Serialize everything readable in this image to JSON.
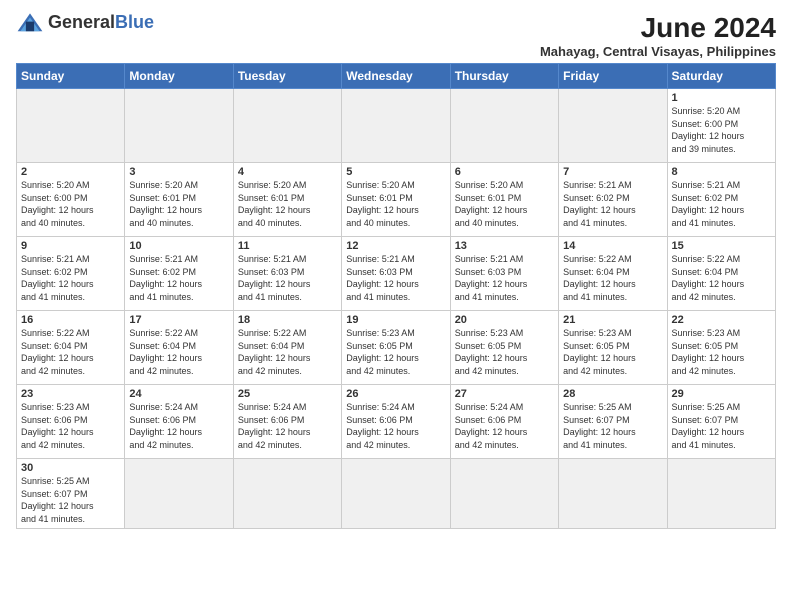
{
  "header": {
    "logo_general": "General",
    "logo_blue": "Blue",
    "month_year": "June 2024",
    "location": "Mahayag, Central Visayas, Philippines"
  },
  "days_of_week": [
    "Sunday",
    "Monday",
    "Tuesday",
    "Wednesday",
    "Thursday",
    "Friday",
    "Saturday"
  ],
  "weeks": [
    [
      {
        "day": "",
        "info": "",
        "empty": true
      },
      {
        "day": "",
        "info": "",
        "empty": true
      },
      {
        "day": "",
        "info": "",
        "empty": true
      },
      {
        "day": "",
        "info": "",
        "empty": true
      },
      {
        "day": "",
        "info": "",
        "empty": true
      },
      {
        "day": "",
        "info": "",
        "empty": true
      },
      {
        "day": "1",
        "info": "Sunrise: 5:20 AM\nSunset: 6:00 PM\nDaylight: 12 hours\nand 39 minutes.",
        "empty": false
      }
    ],
    [
      {
        "day": "2",
        "info": "Sunrise: 5:20 AM\nSunset: 6:00 PM\nDaylight: 12 hours\nand 40 minutes.",
        "empty": false
      },
      {
        "day": "3",
        "info": "Sunrise: 5:20 AM\nSunset: 6:01 PM\nDaylight: 12 hours\nand 40 minutes.",
        "empty": false
      },
      {
        "day": "4",
        "info": "Sunrise: 5:20 AM\nSunset: 6:01 PM\nDaylight: 12 hours\nand 40 minutes.",
        "empty": false
      },
      {
        "day": "5",
        "info": "Sunrise: 5:20 AM\nSunset: 6:01 PM\nDaylight: 12 hours\nand 40 minutes.",
        "empty": false
      },
      {
        "day": "6",
        "info": "Sunrise: 5:20 AM\nSunset: 6:01 PM\nDaylight: 12 hours\nand 40 minutes.",
        "empty": false
      },
      {
        "day": "7",
        "info": "Sunrise: 5:21 AM\nSunset: 6:02 PM\nDaylight: 12 hours\nand 41 minutes.",
        "empty": false
      },
      {
        "day": "8",
        "info": "Sunrise: 5:21 AM\nSunset: 6:02 PM\nDaylight: 12 hours\nand 41 minutes.",
        "empty": false
      }
    ],
    [
      {
        "day": "9",
        "info": "Sunrise: 5:21 AM\nSunset: 6:02 PM\nDaylight: 12 hours\nand 41 minutes.",
        "empty": false
      },
      {
        "day": "10",
        "info": "Sunrise: 5:21 AM\nSunset: 6:02 PM\nDaylight: 12 hours\nand 41 minutes.",
        "empty": false
      },
      {
        "day": "11",
        "info": "Sunrise: 5:21 AM\nSunset: 6:03 PM\nDaylight: 12 hours\nand 41 minutes.",
        "empty": false
      },
      {
        "day": "12",
        "info": "Sunrise: 5:21 AM\nSunset: 6:03 PM\nDaylight: 12 hours\nand 41 minutes.",
        "empty": false
      },
      {
        "day": "13",
        "info": "Sunrise: 5:21 AM\nSunset: 6:03 PM\nDaylight: 12 hours\nand 41 minutes.",
        "empty": false
      },
      {
        "day": "14",
        "info": "Sunrise: 5:22 AM\nSunset: 6:04 PM\nDaylight: 12 hours\nand 41 minutes.",
        "empty": false
      },
      {
        "day": "15",
        "info": "Sunrise: 5:22 AM\nSunset: 6:04 PM\nDaylight: 12 hours\nand 42 minutes.",
        "empty": false
      }
    ],
    [
      {
        "day": "16",
        "info": "Sunrise: 5:22 AM\nSunset: 6:04 PM\nDaylight: 12 hours\nand 42 minutes.",
        "empty": false
      },
      {
        "day": "17",
        "info": "Sunrise: 5:22 AM\nSunset: 6:04 PM\nDaylight: 12 hours\nand 42 minutes.",
        "empty": false
      },
      {
        "day": "18",
        "info": "Sunrise: 5:22 AM\nSunset: 6:04 PM\nDaylight: 12 hours\nand 42 minutes.",
        "empty": false
      },
      {
        "day": "19",
        "info": "Sunrise: 5:23 AM\nSunset: 6:05 PM\nDaylight: 12 hours\nand 42 minutes.",
        "empty": false
      },
      {
        "day": "20",
        "info": "Sunrise: 5:23 AM\nSunset: 6:05 PM\nDaylight: 12 hours\nand 42 minutes.",
        "empty": false
      },
      {
        "day": "21",
        "info": "Sunrise: 5:23 AM\nSunset: 6:05 PM\nDaylight: 12 hours\nand 42 minutes.",
        "empty": false
      },
      {
        "day": "22",
        "info": "Sunrise: 5:23 AM\nSunset: 6:05 PM\nDaylight: 12 hours\nand 42 minutes.",
        "empty": false
      }
    ],
    [
      {
        "day": "23",
        "info": "Sunrise: 5:23 AM\nSunset: 6:06 PM\nDaylight: 12 hours\nand 42 minutes.",
        "empty": false
      },
      {
        "day": "24",
        "info": "Sunrise: 5:24 AM\nSunset: 6:06 PM\nDaylight: 12 hours\nand 42 minutes.",
        "empty": false
      },
      {
        "day": "25",
        "info": "Sunrise: 5:24 AM\nSunset: 6:06 PM\nDaylight: 12 hours\nand 42 minutes.",
        "empty": false
      },
      {
        "day": "26",
        "info": "Sunrise: 5:24 AM\nSunset: 6:06 PM\nDaylight: 12 hours\nand 42 minutes.",
        "empty": false
      },
      {
        "day": "27",
        "info": "Sunrise: 5:24 AM\nSunset: 6:06 PM\nDaylight: 12 hours\nand 42 minutes.",
        "empty": false
      },
      {
        "day": "28",
        "info": "Sunrise: 5:25 AM\nSunset: 6:07 PM\nDaylight: 12 hours\nand 41 minutes.",
        "empty": false
      },
      {
        "day": "29",
        "info": "Sunrise: 5:25 AM\nSunset: 6:07 PM\nDaylight: 12 hours\nand 41 minutes.",
        "empty": false
      }
    ],
    [
      {
        "day": "30",
        "info": "Sunrise: 5:25 AM\nSunset: 6:07 PM\nDaylight: 12 hours\nand 41 minutes.",
        "empty": false
      },
      {
        "day": "",
        "info": "",
        "empty": true
      },
      {
        "day": "",
        "info": "",
        "empty": true
      },
      {
        "day": "",
        "info": "",
        "empty": true
      },
      {
        "day": "",
        "info": "",
        "empty": true
      },
      {
        "day": "",
        "info": "",
        "empty": true
      },
      {
        "day": "",
        "info": "",
        "empty": true
      }
    ]
  ]
}
